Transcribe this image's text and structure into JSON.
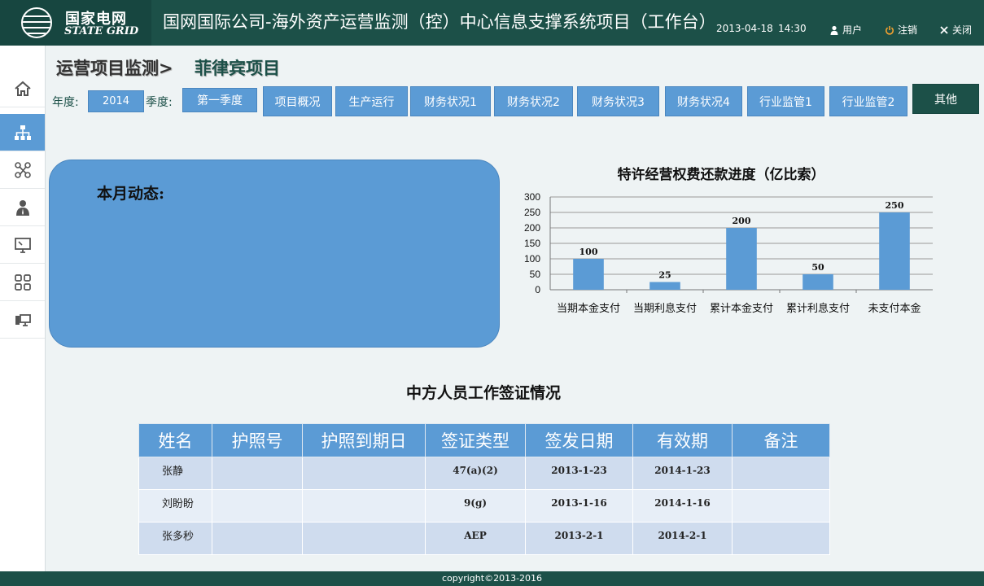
{
  "header": {
    "logo_cn": "国家电网",
    "logo_en": "STATE GRID",
    "title": "国网国际公司-海外资产运营监测（控）中心信息支撑系统项目（工作台）",
    "date": "2013-04-18",
    "time": "14:30",
    "user_label": "用户",
    "logout_label": "注销",
    "close_label": "关闭"
  },
  "sidebar": {
    "items": [
      {
        "icon": "home-icon",
        "active": false
      },
      {
        "icon": "org-chart-icon",
        "active": true
      },
      {
        "icon": "network-icon",
        "active": false
      },
      {
        "icon": "person-icon",
        "active": false
      },
      {
        "icon": "monitor-icon",
        "active": false
      },
      {
        "icon": "grid-icon",
        "active": false
      },
      {
        "icon": "computer-icon",
        "active": false
      }
    ]
  },
  "breadcrumb": {
    "parent": "运营项目监测>",
    "current": "菲律宾项目"
  },
  "filters": {
    "year_label": "年度:",
    "year_value": "2014",
    "quarter_label": "季度:",
    "quarter_value": "第一季度"
  },
  "tabs": [
    "项目概况",
    "生产运行",
    "财务状况1",
    "财务状况2",
    "财务状况3",
    "财务状况4",
    "行业监管1",
    "行业监管2",
    "其他"
  ],
  "monthly": {
    "title": "本月动态:"
  },
  "chart_data": {
    "type": "bar",
    "title": "特许经营权费还款进度（亿比索）",
    "categories": [
      "当期本金支付",
      "当期利息支付",
      "累计本金支付",
      "累计利息支付",
      "未支付本金"
    ],
    "values": [
      100,
      25,
      200,
      50,
      250
    ],
    "ylim": [
      0,
      300
    ],
    "yticks": [
      0,
      50,
      100,
      150,
      200,
      250,
      300
    ],
    "grid": true,
    "bar_color": "#5b9bd5"
  },
  "visa_table": {
    "title": "中方人员工作签证情况",
    "headers": [
      "姓名",
      "护照号",
      "护照到期日",
      "签证类型",
      "签发日期",
      "有效期",
      "备注"
    ],
    "rows": [
      [
        "张静",
        "",
        "",
        "47(a)(2)",
        "2013-1-23",
        "2014-1-23",
        ""
      ],
      [
        "刘盼盼",
        "",
        "",
        "9(g)",
        "2013-1-16",
        "2014-1-16",
        ""
      ],
      [
        "张多秒",
        "",
        "",
        "AEP",
        "2013-2-1",
        "2014-2-1",
        ""
      ]
    ]
  },
  "footer": {
    "copyright": "copyright©2013-2016"
  },
  "colors": {
    "brand_dark": "#1c5048",
    "accent_blue": "#5b9bd5",
    "background": "#eef3f4"
  }
}
